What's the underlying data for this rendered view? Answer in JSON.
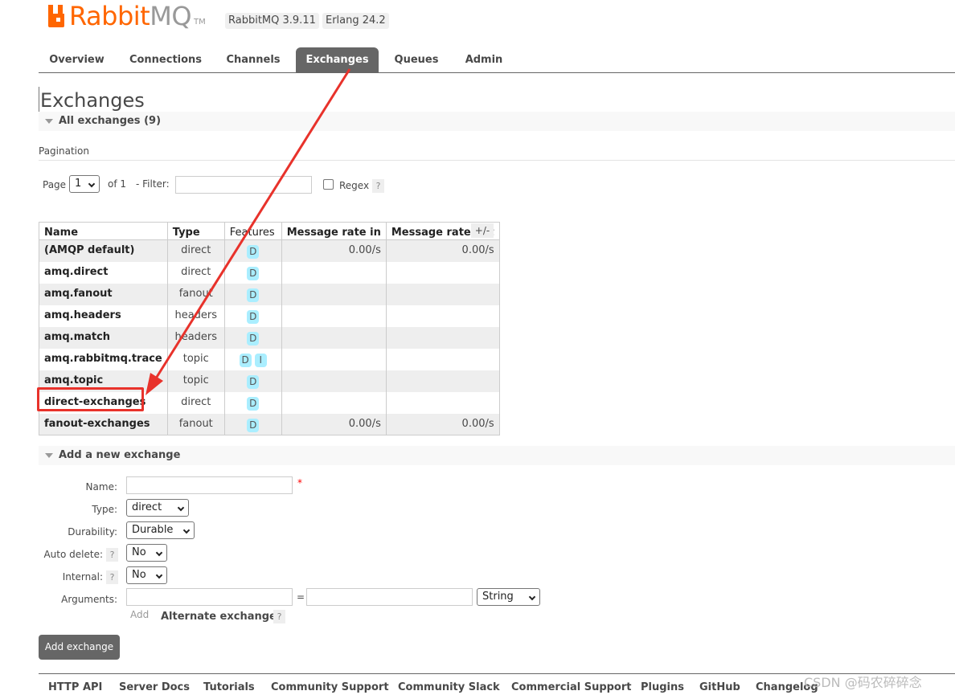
{
  "header": {
    "logo_text_a": "Rabbit",
    "logo_text_b": "MQ",
    "logo_tm": "TM",
    "versions": [
      "RabbitMQ 3.9.11",
      "Erlang 24.2"
    ]
  },
  "nav": {
    "tabs": [
      {
        "label": "Overview"
      },
      {
        "label": "Connections"
      },
      {
        "label": "Channels"
      },
      {
        "label": "Exchanges"
      },
      {
        "label": "Queues"
      },
      {
        "label": "Admin"
      }
    ],
    "active": "Exchanges"
  },
  "page": {
    "title": "Exchanges",
    "all_exchanges": "All exchanges (9)"
  },
  "pagination": {
    "section_label": "Pagination",
    "page_label": "Page",
    "page_value": "1",
    "of_label": "of 1",
    "filter_label": "- Filter:",
    "filter_value": "",
    "regex_label": "Regex",
    "help": "?"
  },
  "table": {
    "headers": [
      "Name",
      "Type",
      "Features",
      "Message rate in",
      "Message rate out"
    ],
    "plusminus": "+/-",
    "rows": [
      {
        "name": "(AMQP default)",
        "type": "direct",
        "features": [
          "D"
        ],
        "rate_in": "0.00/s",
        "rate_out": "0.00/s"
      },
      {
        "name": "amq.direct",
        "type": "direct",
        "features": [
          "D"
        ],
        "rate_in": "",
        "rate_out": ""
      },
      {
        "name": "amq.fanout",
        "type": "fanout",
        "features": [
          "D"
        ],
        "rate_in": "",
        "rate_out": ""
      },
      {
        "name": "amq.headers",
        "type": "headers",
        "features": [
          "D"
        ],
        "rate_in": "",
        "rate_out": ""
      },
      {
        "name": "amq.match",
        "type": "headers",
        "features": [
          "D"
        ],
        "rate_in": "",
        "rate_out": ""
      },
      {
        "name": "amq.rabbitmq.trace",
        "type": "topic",
        "features": [
          "D",
          "I"
        ],
        "rate_in": "",
        "rate_out": ""
      },
      {
        "name": "amq.topic",
        "type": "topic",
        "features": [
          "D"
        ],
        "rate_in": "",
        "rate_out": ""
      },
      {
        "name": "direct-exchanges",
        "type": "direct",
        "features": [
          "D"
        ],
        "rate_in": "",
        "rate_out": ""
      },
      {
        "name": "fanout-exchanges",
        "type": "fanout",
        "features": [
          "D"
        ],
        "rate_in": "0.00/s",
        "rate_out": "0.00/s"
      }
    ]
  },
  "add_exchange": {
    "section_title": "Add a new exchange",
    "name_label": "Name:",
    "name_value": "",
    "required_mark": "*",
    "type_label": "Type:",
    "type_value": "direct",
    "durability_label": "Durability:",
    "durability_value": "Durable",
    "auto_delete_label": "Auto delete:",
    "auto_delete_value": "No",
    "internal_label": "Internal:",
    "internal_value": "No",
    "arguments_label": "Arguments:",
    "equals": "=",
    "arg_type_value": "String",
    "add_link": "Add",
    "alternate_exchange": "Alternate exchange",
    "help": "?",
    "submit_label": "Add exchange"
  },
  "footer": {
    "links": [
      "HTTP API",
      "Server Docs",
      "Tutorials",
      "Community Support",
      "Community Slack",
      "Commercial Support",
      "Plugins",
      "GitHub",
      "Changelog"
    ]
  },
  "watermark": "CSDN @码农碎碎念",
  "colors": {
    "brand": "#ff6600",
    "active_tab": "#666666",
    "feature_tag": "#aaeeff",
    "annotation": "#e8322b"
  }
}
